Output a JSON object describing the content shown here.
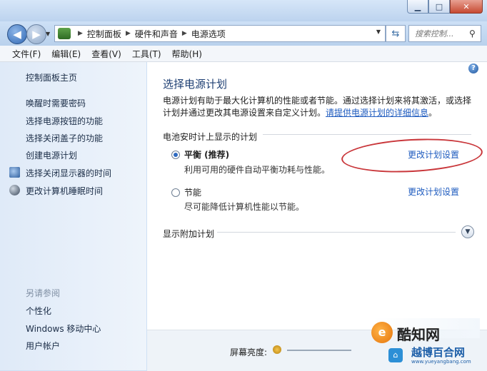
{
  "window": {
    "controls": {
      "minimize": "▁",
      "maximize": "□",
      "close": "✕"
    }
  },
  "toolbar": {
    "back": "◀",
    "forward": "▶",
    "breadcrumb": [
      "控制面板",
      "硬件和声音",
      "电源选项"
    ],
    "search_placeholder": "搜索控制..."
  },
  "menu": [
    "文件(F)",
    "编辑(E)",
    "查看(V)",
    "工具(T)",
    "帮助(H)"
  ],
  "sidebar": {
    "home": "控制面板主页",
    "links": [
      "唤醒时需要密码",
      "选择电源按钮的功能",
      "选择关闭盖子的功能",
      "创建电源计划",
      "选择关闭显示器的时间",
      "更改计算机睡眠时间"
    ],
    "see_also_title": "另请参阅",
    "see_also": [
      "个性化",
      "Windows 移动中心",
      "用户帐户"
    ]
  },
  "main": {
    "title": "选择电源计划",
    "description": "电源计划有助于最大化计算机的性能或者节能。通过选择计划来将其激活，或选择计划并通过更改其电源设置来自定义计划。",
    "description_link": "请提供电源计划的详细信息",
    "section": "电池安时计上显示的计划",
    "plans": [
      {
        "name": "平衡 (推荐)",
        "desc": "利用可用的硬件自动平衡功耗与性能。",
        "link": "更改计划设置",
        "selected": true
      },
      {
        "name": "节能",
        "desc": "尽可能降低计算机性能以节能。",
        "link": "更改计划设置",
        "selected": false
      }
    ],
    "extra": "显示附加计划",
    "brightness_label": "屏幕亮度:",
    "annotation_color": "#c9363a"
  },
  "watermark": {
    "brand1": "酷知网",
    "brand2": "越博百合网",
    "url": "www.yueyangbang.com"
  }
}
